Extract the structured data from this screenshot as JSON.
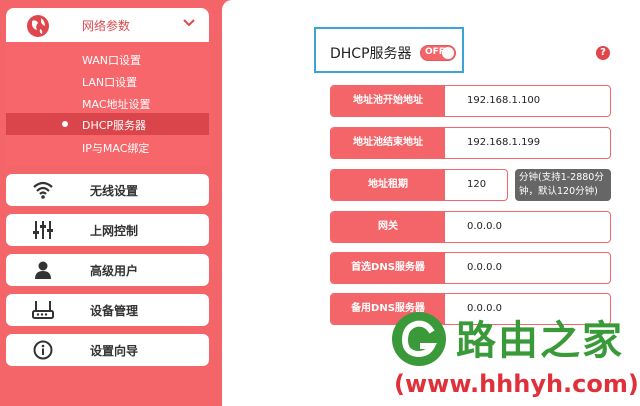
{
  "sidebar": {
    "network": {
      "title": "网络参数",
      "items": [
        {
          "label": "WAN口设置"
        },
        {
          "label": "LAN口设置"
        },
        {
          "label": "MAC地址设置"
        },
        {
          "label": "DHCP服务器"
        },
        {
          "label": "IP与MAC绑定"
        }
      ]
    },
    "menu": [
      {
        "label": "无线设置",
        "icon": "wifi-icon"
      },
      {
        "label": "上网控制",
        "icon": "sliders-icon"
      },
      {
        "label": "高级用户",
        "icon": "user-icon"
      },
      {
        "label": "设备管理",
        "icon": "router-icon"
      },
      {
        "label": "设置向导",
        "icon": "info-icon"
      }
    ]
  },
  "main": {
    "section_title": "DHCP服务器",
    "toggle_label": "OFF",
    "help_label": "?",
    "fields": [
      {
        "label": "地址池开始地址",
        "value": "192.168.1.100"
      },
      {
        "label": "地址池结束地址",
        "value": "192.168.1.199"
      },
      {
        "label": "地址租期",
        "value": "120"
      },
      {
        "label": "网关",
        "value": "0.0.0.0"
      },
      {
        "label": "首选DNS服务器",
        "value": "0.0.0.0"
      },
      {
        "label": "备用DNS服务器",
        "value": "0.0.0.0"
      }
    ],
    "lease_hint": "分钟(支持1-2880分钟，默认120分钟)"
  },
  "watermark": {
    "title": "路由之家",
    "url": "(www.hhhyh.com)"
  },
  "colors": {
    "brand": "#f4656a",
    "active": "#d9454a",
    "highlight_border": "#3aa3d8",
    "watermark_green": "#3a9a3a",
    "watermark_red": "#e0313a"
  }
}
